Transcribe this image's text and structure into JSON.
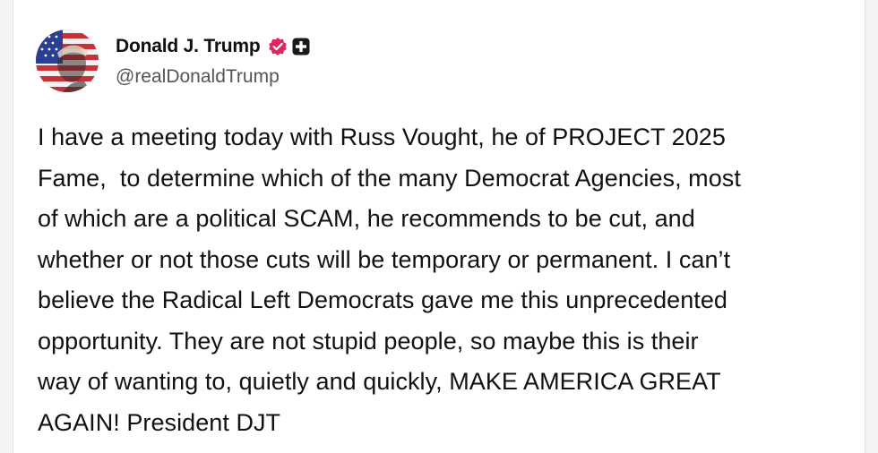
{
  "author": {
    "display_name": "Donald J. Trump",
    "handle": "@realDonaldTrump",
    "avatar_icon": "profile-avatar",
    "verified_icon": "verified-badge-icon",
    "verified_color": "#e0245e",
    "plus_icon": "plus-badge-icon",
    "plus_color": "#1a1a1a"
  },
  "post": {
    "lines": [
      "I have a meeting today with Russ Vought, he of PROJECT 2025",
      "Fame,  to determine which of the many Democrat Agencies, most",
      "of which are a political SCAM, he recommends to be cut, and",
      "whether or not those cuts will be temporary or permanent. I can’t",
      "believe the Radical Left Democrats gave me this unprecedented",
      "opportunity. They are not stupid people, so maybe this is their",
      "way of wanting to, quietly and quickly, MAKE AMERICA GREAT",
      "AGAIN! President DJT"
    ]
  }
}
